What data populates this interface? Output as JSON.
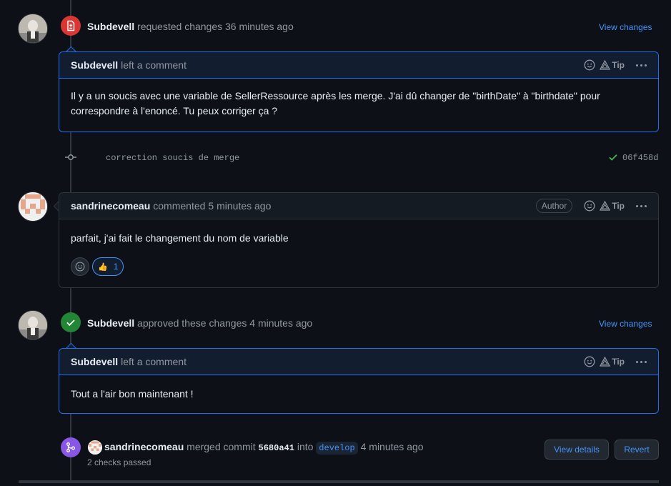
{
  "review1": {
    "author": "Subdevell",
    "action": "requested changes",
    "time": "36 minutes ago",
    "view_changes": "View changes"
  },
  "comment1": {
    "author": "Subdevell",
    "action": "left a comment",
    "tip": "Tip",
    "body": "Il y a un soucis avec une variable de SellerRessource après les merge. J'ai dû changer de \"birthDate\" à \"birthdate\" pour correspondre à l'enoncé. Tu peux corriger ça ?"
  },
  "commit": {
    "message": "correction soucis de merge",
    "sha": "06f458d"
  },
  "comment2": {
    "author": "sandrinecomeau",
    "action": "commented",
    "time": "5 minutes ago",
    "author_badge": "Author",
    "tip": "Tip",
    "body": "parfait, j'ai fait le changement du nom de variable",
    "reaction_emoji": "👍",
    "reaction_count": "1"
  },
  "review2": {
    "author": "Subdevell",
    "action": "approved these changes",
    "time": "4 minutes ago",
    "view_changes": "View changes"
  },
  "comment3": {
    "author": "Subdevell",
    "action": "left a comment",
    "tip": "Tip",
    "body": "Tout a l'air bon maintenant !"
  },
  "merge": {
    "author": "sandrinecomeau",
    "action": "merged commit",
    "commit": "5680a41",
    "into": "into",
    "branch": "develop",
    "time": "4 minutes ago",
    "checks": "2 checks passed",
    "view_details": "View details",
    "revert": "Revert"
  },
  "colors": {
    "background": "#0d1117",
    "changes_requested": "#da3633",
    "approved": "#238636",
    "merged": "#8957e5",
    "link": "#4493f8"
  }
}
